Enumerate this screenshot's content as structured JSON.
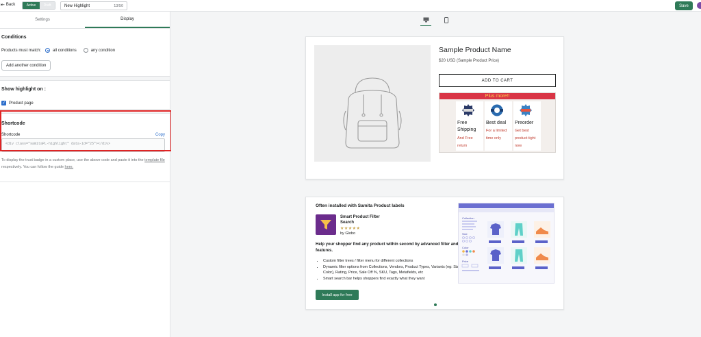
{
  "topbar": {
    "back_label": "Back",
    "status_active": "Active",
    "status_draft": "Draft",
    "name_value": "New Highlight",
    "name_count": "13/50",
    "save_label": "Save"
  },
  "left": {
    "tabs": [
      {
        "label": "Settings"
      },
      {
        "label": "Display"
      }
    ],
    "conditions": {
      "title": "Conditions",
      "match_label": "Products must match:",
      "option_all": "all conditions",
      "option_any": "any condition",
      "add_label": "Add another condition"
    },
    "show": {
      "title": "Show highlight on :",
      "product_page": "Product page"
    },
    "shortcode": {
      "title": "Shortcode",
      "field_label": "Shortcode",
      "copy_label": "Copy",
      "code_value": "<div class=\"samitaPL-highlight\" data-id=\"25\"></div>",
      "help_part1": "To display the trust badge in a custom place, use the above code and paste it into the",
      "help_link1": "template file",
      "help_part2": " respectively. You can follow the guide ",
      "help_link2": "here."
    }
  },
  "preview": {
    "product": {
      "title": "Sample Product Name",
      "price": "$20 USD (Sample Product Price)",
      "add_to_cart": "ADD TO CART"
    },
    "badges": {
      "header": "Plus more!!",
      "items": [
        {
          "title": "Free Shipping",
          "sub": "And Free return",
          "icon": "sale-badge-icon"
        },
        {
          "title": "Best deal",
          "sub": "For a limited time only",
          "icon": "best-deal-badge-icon"
        },
        {
          "title": "Preorder",
          "sub": "Get best product tight now",
          "icon": "now-badge-icon"
        }
      ]
    },
    "promo": {
      "title": "Often installed with Samita Product labels",
      "app_name": "Smart Product Filter Search",
      "stars": "★★★★★",
      "by": "by Globo",
      "description": "Help your shopper find any product within second by advanced filter and search features.",
      "bullets": [
        "Custom filter trees / filter menu for different collections",
        "Dynamic filter options from Collections, Vendors, Product Types, Variants (eg: Size, Color), Rating, Price, Sale Off %, SKU, Tags, Metafields, etc",
        "Smart search bar helps shoppers find exactly what they want"
      ],
      "install_label": "Install app for free",
      "mock_labels": {
        "collection": "Collection",
        "size": "Size",
        "color": "Color",
        "price": "Price"
      }
    }
  },
  "colors": {
    "primary": "#2f7a58",
    "link": "#2c6ecb",
    "highlight_border": "#e02424",
    "badge_header": "#d93545"
  }
}
